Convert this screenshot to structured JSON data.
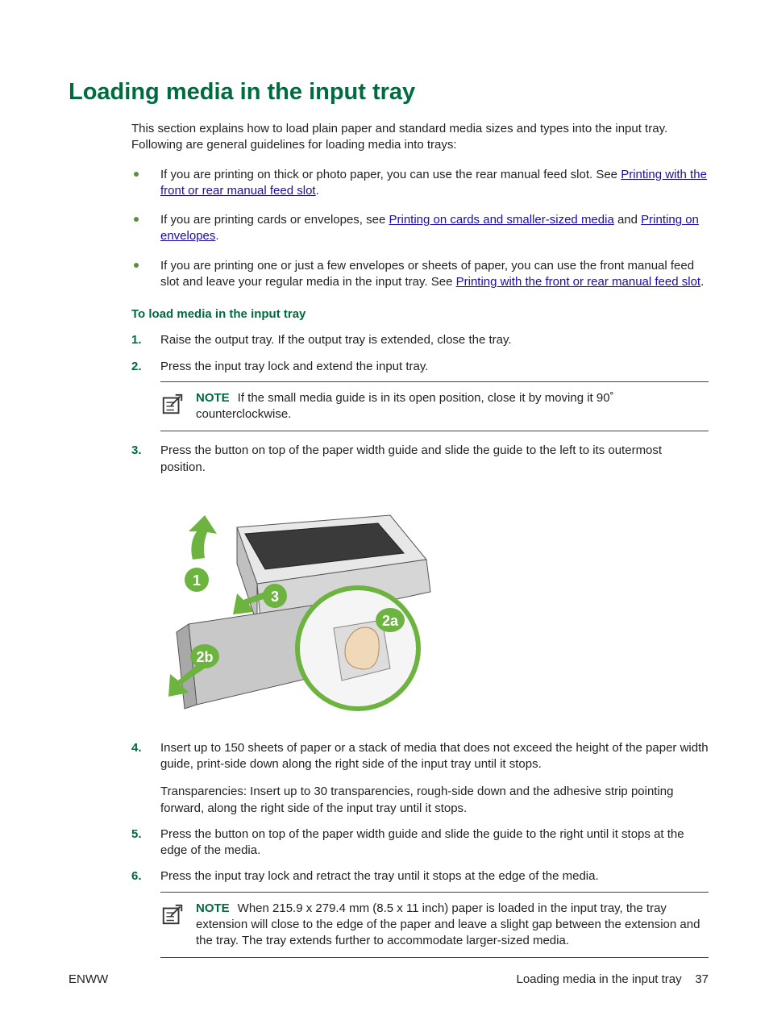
{
  "title": "Loading media in the input tray",
  "intro": "This section explains how to load plain paper and standard media sizes and types into the input tray. Following are general guidelines for loading media into trays:",
  "bullets": [
    {
      "pre": "If you are printing on thick or photo paper, you can use the rear manual feed slot. See ",
      "link1": "Printing with the front or rear manual feed slot",
      "post": "."
    },
    {
      "pre": "If you are printing cards or envelopes, see ",
      "link1": "Printing on cards and smaller-sized media",
      "mid": " and ",
      "link2": "Printing on envelopes",
      "post": "."
    },
    {
      "pre": "If you are printing one or just a few envelopes or sheets of paper, you can use the front manual feed slot and leave your regular media in the input tray. See ",
      "link1": "Printing with the front or rear manual feed slot",
      "post": "."
    }
  ],
  "sub_head": "To load media in the input tray",
  "steps": {
    "n1": "1.",
    "s1": "Raise the output tray. If the output tray is extended, close the tray.",
    "n2": "2.",
    "s2": "Press the input tray lock and extend the input tray.",
    "note1_label": "NOTE",
    "note1": "If the small media guide is in its open position, close it by moving it 90˚ counterclockwise.",
    "n3": "3.",
    "s3": "Press the button on top of the paper width guide and slide the guide to the left to its outermost position.",
    "n4": "4.",
    "s4a": "Insert up to 150 sheets of paper or a stack of media that does not exceed the height of the paper width guide, print-side down along the right side of the input tray until it stops.",
    "s4b": "Transparencies: Insert up to 30 transparencies, rough-side down and the adhesive strip pointing forward, along the right side of the input tray until it stops.",
    "n5": "5.",
    "s5": "Press the button on top of the paper width guide and slide the guide to the right until it stops at the edge of the media.",
    "n6": "6.",
    "s6": "Press the input tray lock and retract the tray until it stops at the edge of the media.",
    "note2_label": "NOTE",
    "note2": "When 215.9 x 279.4 mm (8.5 x 11 inch) paper is loaded in the input tray, the tray extension will close to the edge of the paper and leave a slight gap between the extension and the tray. The tray extends further to accommodate larger-sized media."
  },
  "callouts": {
    "c1": "1",
    "c2a": "2a",
    "c2b": "2b",
    "c3": "3"
  },
  "footer": {
    "left": "ENWW",
    "center": "Loading media in the input tray",
    "page": "37"
  }
}
